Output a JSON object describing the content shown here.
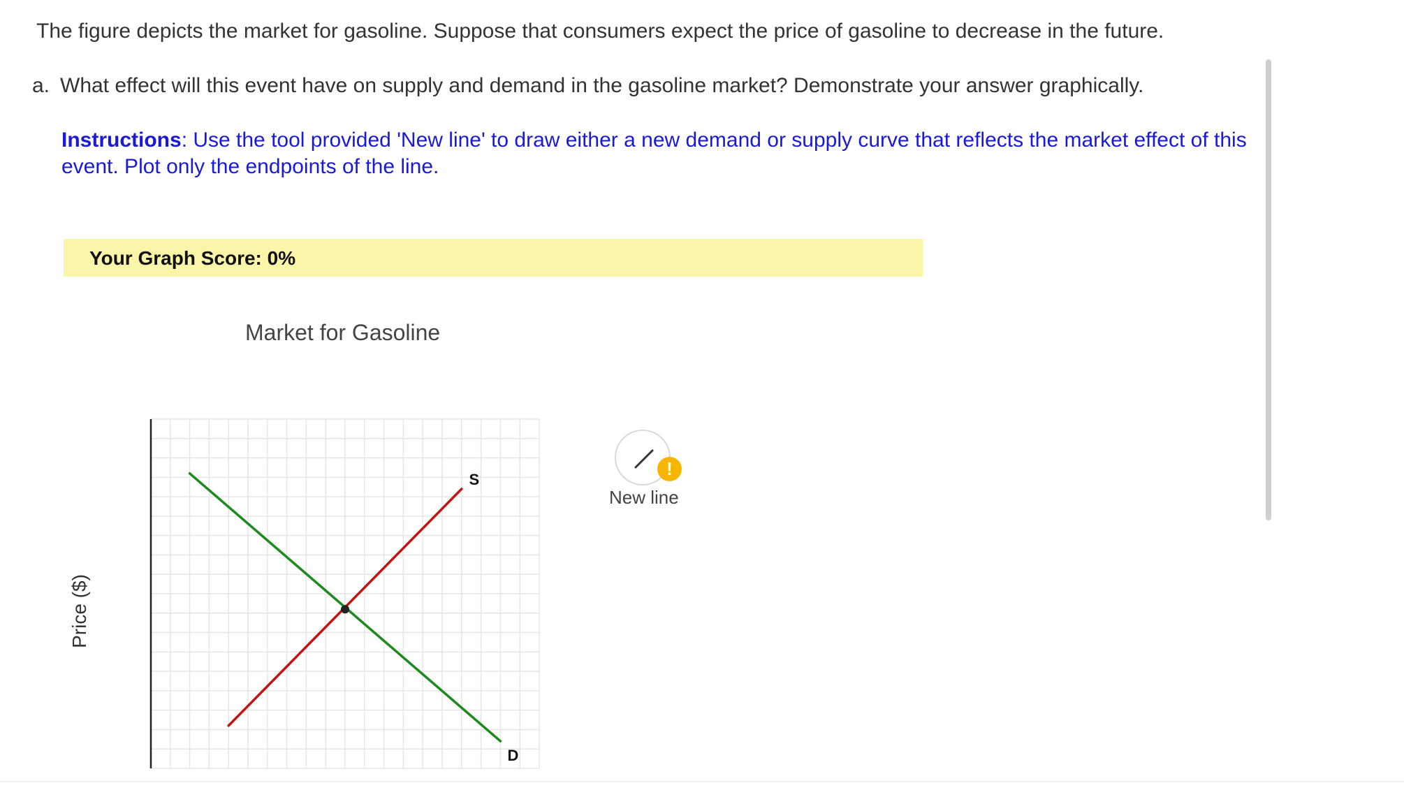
{
  "question": {
    "text": "The figure depicts the market for gasoline. Suppose that consumers expect the price of gasoline to decrease in the future."
  },
  "part_a": {
    "marker": "a.",
    "text": "What effect will this event have on supply and demand in the gasoline market? Demonstrate your answer graphically."
  },
  "instructions": {
    "label": "Instructions",
    "text": ": Use the tool provided 'New line' to draw either a new demand or supply curve that reflects the market effect of this event. Plot only the endpoints of the line."
  },
  "score": {
    "text": "Your Graph Score: 0%"
  },
  "graph": {
    "title": "Market for Gasoline",
    "ylabel": "Price ($)",
    "colors": {
      "supply": "#c21414",
      "demand": "#1c8a1c",
      "grid": "#e6e6e6",
      "axis": "#222222",
      "equilibrium": "#222222"
    }
  },
  "tool": {
    "label": "New line",
    "icon": "pencil-icon",
    "warning_icon": "warning-icon",
    "warning_glyph": "!"
  },
  "chart_data": {
    "type": "line",
    "title": "Market for Gasoline",
    "xlabel": "",
    "ylabel": "Price ($)",
    "xlim": [
      0,
      20
    ],
    "ylim": [
      0,
      18
    ],
    "grid": true,
    "legend": "none",
    "series": [
      {
        "name": "S",
        "x": [
          4,
          16
        ],
        "y": [
          2.2,
          14.4
        ]
      },
      {
        "name": "D",
        "x": [
          2,
          18
        ],
        "y": [
          15.2,
          1.4
        ]
      }
    ],
    "equilibrium": {
      "x": 10,
      "y": 8.2
    }
  }
}
